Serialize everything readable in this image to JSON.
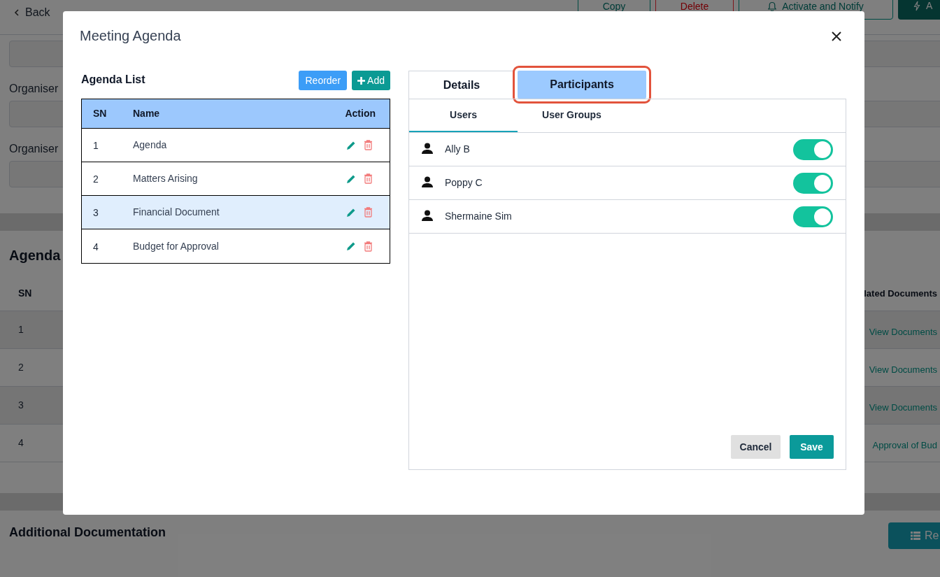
{
  "page": {
    "back": "Back",
    "actions": [
      {
        "label": "Copy",
        "kind": "outline"
      },
      {
        "label": "Delete",
        "kind": "danger"
      },
      {
        "label": "Activate and Notify",
        "kind": "bell"
      },
      {
        "label": "A",
        "kind": "primary"
      }
    ],
    "organiser_labels": [
      "Organiser",
      "Organiser"
    ],
    "agenda_title": "Agenda",
    "agenda_table": {
      "columns": [
        "SN",
        "lated Documents"
      ],
      "rows": [
        {
          "sn": "1",
          "documents": "View Documents"
        },
        {
          "sn": "2",
          "documents": "View Documents"
        },
        {
          "sn": "3",
          "documents": "View Documents"
        },
        {
          "sn": "4",
          "documents": "Approval of Bud"
        }
      ]
    },
    "additional_title": "Additional Documentation",
    "additional_button": "Re"
  },
  "dialog": {
    "title": "Meeting Agenda",
    "agenda_list": {
      "title": "Agenda List",
      "buttons": [
        {
          "label": "Reorder",
          "kind": "reorder"
        },
        {
          "label": "Add",
          "kind": "add"
        }
      ],
      "columns": [
        "SN",
        "Name",
        "Action"
      ],
      "rows": [
        {
          "sn": "1",
          "name": "Agenda",
          "selected": false
        },
        {
          "sn": "2",
          "name": "Matters Arising",
          "selected": false
        },
        {
          "sn": "3",
          "name": "Financial Document",
          "selected": true
        },
        {
          "sn": "4",
          "name": "Budget for Approval",
          "selected": false
        }
      ]
    },
    "tabs": [
      {
        "label": "Details",
        "selected": false
      },
      {
        "label": "Participants",
        "selected": true
      }
    ],
    "subtabs": [
      {
        "label": "Users",
        "selected": true
      },
      {
        "label": "User Groups",
        "selected": false
      }
    ],
    "users": [
      {
        "name": "Ally B",
        "on": true
      },
      {
        "name": "Poppy C",
        "on": true
      },
      {
        "name": "Shermaine Sim",
        "on": true
      }
    ],
    "buttons": [
      {
        "label": "Cancel",
        "kind": "secondary"
      },
      {
        "label": "Save",
        "kind": "primary"
      }
    ]
  }
}
